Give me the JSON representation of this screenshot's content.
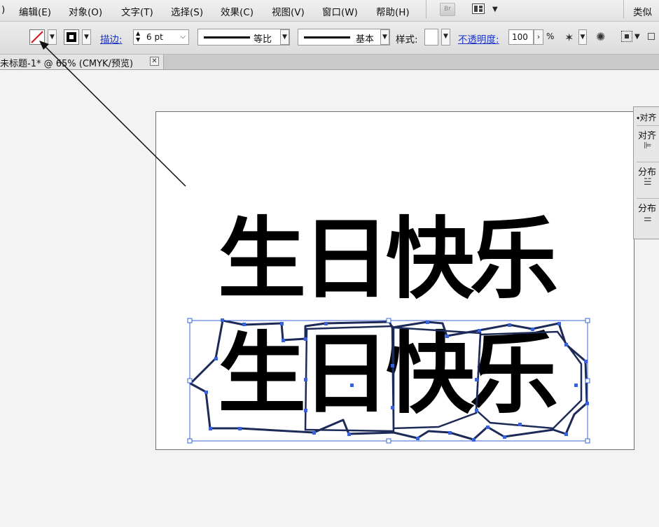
{
  "menu": {
    "items": [
      "编辑(E)",
      "对象(O)",
      "文字(T)",
      "选择(S)",
      "效果(C)",
      "视图(V)",
      "窗口(W)",
      "帮助(H)"
    ],
    "leading_fragment": ")",
    "bridge_label": "Br",
    "right_label": "类似"
  },
  "control": {
    "stroke_link": "描边:",
    "stroke_weight": "6 pt",
    "profile_label": "等比",
    "brush_label": "基本",
    "style_label": "样式:",
    "opacity_link": "不透明度:",
    "opacity_value": "100",
    "percent": "%"
  },
  "tab": {
    "label": "未标题-1* @ 65% (CMYK/预览)",
    "close": "✕"
  },
  "artboard": {
    "text_top": "生日快乐",
    "text_outlined": "生日快乐"
  },
  "align_panel": {
    "title": "⬩对齐",
    "section1": "对齐",
    "section2": "分布",
    "section3": "分布"
  },
  "colors": {
    "link_blue": "#1a33c7",
    "selection_blue": "#3a62d6",
    "fill_none_red": "#d01818"
  }
}
